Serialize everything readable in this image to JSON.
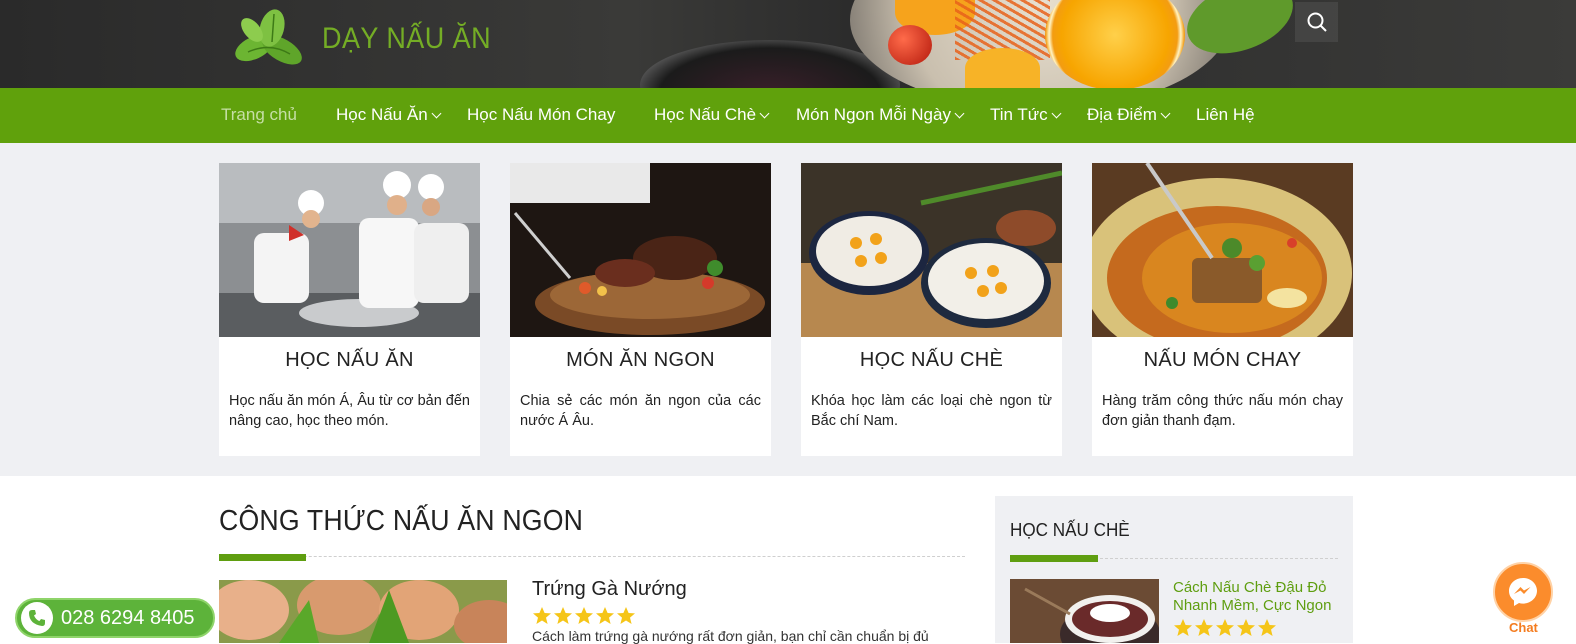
{
  "header": {
    "logo_text": "DẠY NẤU ĂN",
    "search_icon": "search-icon"
  },
  "nav": {
    "items": [
      {
        "label": "Trang chủ",
        "active": true,
        "dropdown": false
      },
      {
        "label": "Học Nấu Ăn",
        "dropdown": true
      },
      {
        "label": "Học Nấu Món Chay",
        "dropdown": false
      },
      {
        "label": "Học Nấu Chè",
        "dropdown": true
      },
      {
        "label": "Món Ngon Mỗi Ngày",
        "dropdown": true
      },
      {
        "label": "Tin Tức",
        "dropdown": true
      },
      {
        "label": "Địa Điểm",
        "dropdown": true
      },
      {
        "label": "Liên Hệ",
        "dropdown": false
      }
    ]
  },
  "features": [
    {
      "title": "HỌC NẤU ĂN",
      "desc": "Học nấu ăn món Á, Âu từ cơ bản đến nâng cao, học theo món."
    },
    {
      "title": "MÓN ĂN NGON",
      "desc": "Chia sẻ các món ăn ngon của các nước Á Âu."
    },
    {
      "title": "HỌC NẤU CHÈ",
      "desc": "Khóa học làm các loại chè ngon từ Bắc chí Nam."
    },
    {
      "title": "NẤU MÓN CHAY",
      "desc": "Hàng trăm công thức nấu món chay đơn giản thanh đạm."
    }
  ],
  "main": {
    "section_title": "CÔNG THỨC NẤU ĂN NGON",
    "post": {
      "title": "Trứng Gà Nướng",
      "rating": 5,
      "excerpt": "Cách làm trứng gà nướng rất đơn giản, bạn chỉ cần chuẩn bị đủ"
    }
  },
  "sidebar": {
    "title": "HỌC NẤU CHÈ",
    "post": {
      "title": "Cách Nấu Chè Đậu Đỏ Nhanh Mềm, Cực Ngon",
      "rating": 5
    }
  },
  "floating": {
    "phone": "028 6294 8405",
    "chat_label": "Chat"
  },
  "colors": {
    "brand_green": "#60a10c",
    "star_yellow": "#f5c518",
    "chat_orange": "#fb8c2c"
  }
}
